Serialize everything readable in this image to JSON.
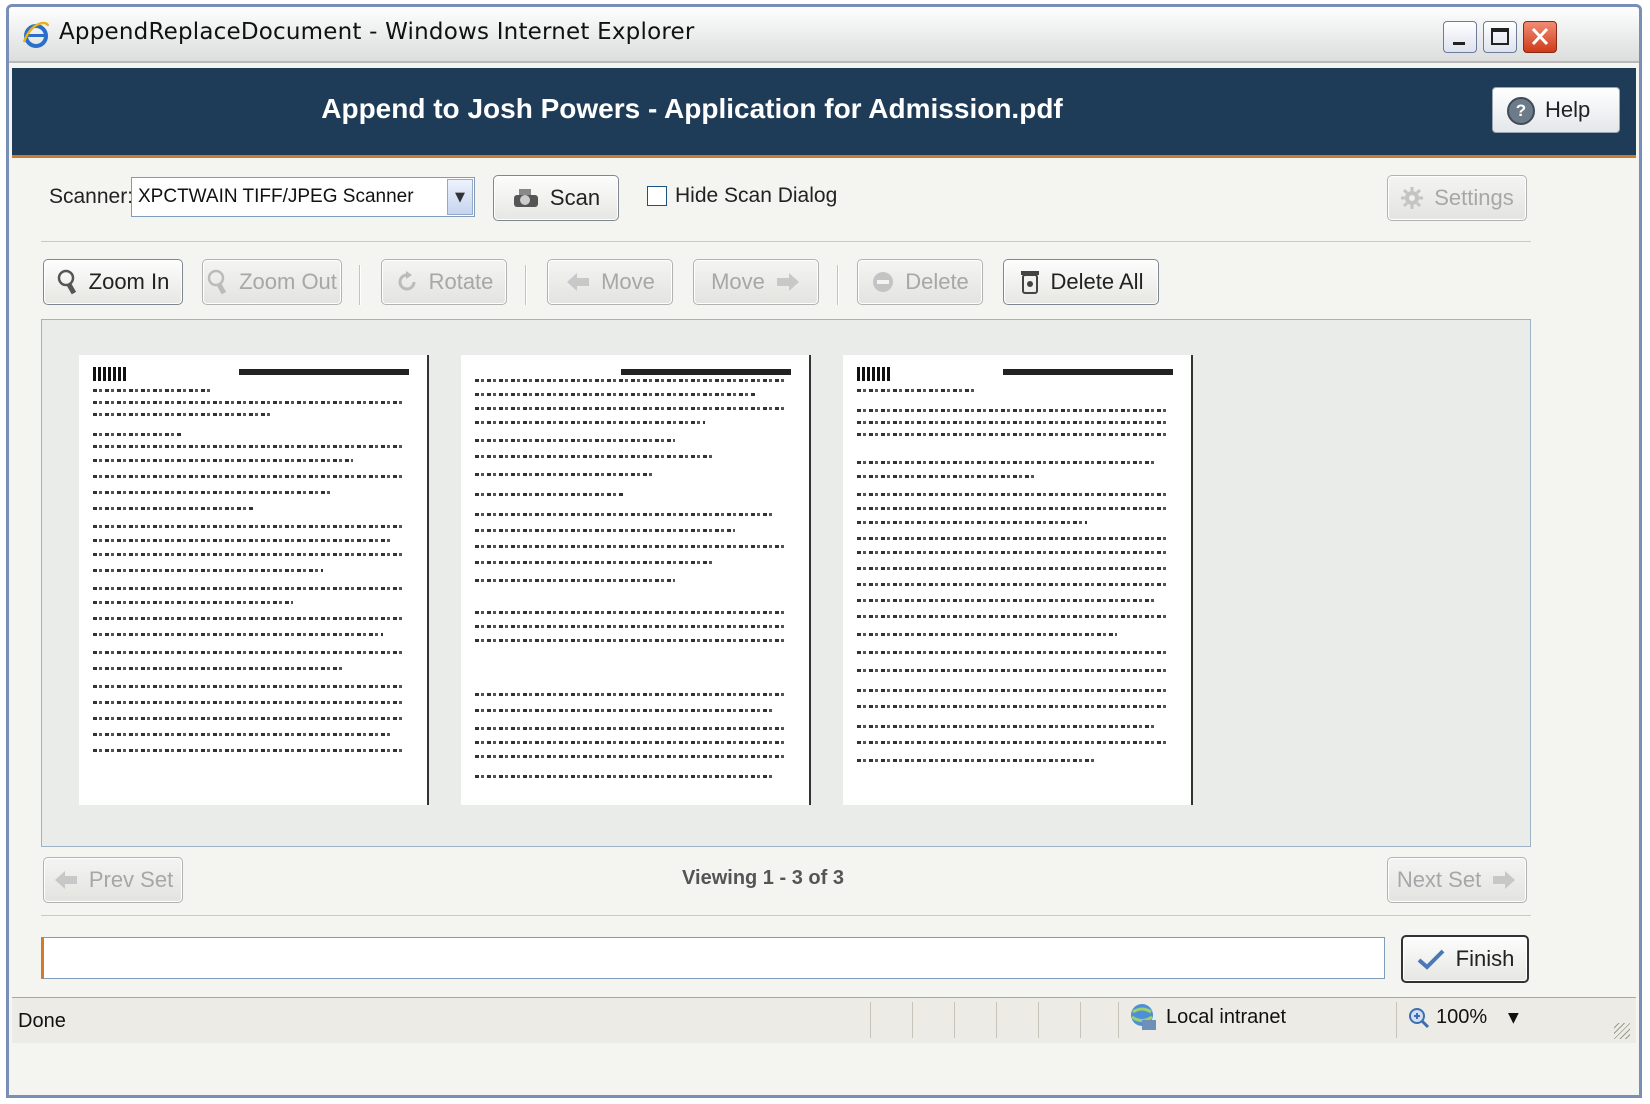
{
  "window": {
    "title": "AppendReplaceDocument - Windows Internet Explorer"
  },
  "header": {
    "title": "Append to Josh Powers - Application for Admission.pdf",
    "help_label": "Help"
  },
  "scan_bar": {
    "scanner_label": "Scanner:",
    "scanner_value": "XPCTWAIN TIFF/JPEG Scanner",
    "scan_label": "Scan",
    "hide_dialog_label": "Hide Scan Dialog",
    "hide_dialog_checked": false,
    "settings_label": "Settings"
  },
  "toolbar": {
    "zoom_in": "Zoom In",
    "zoom_out": "Zoom Out",
    "rotate": "Rotate",
    "move_left": "Move",
    "move_right": "Move",
    "delete": "Delete",
    "delete_all": "Delete All"
  },
  "pager": {
    "prev_label": "Prev Set",
    "next_label": "Next Set",
    "viewing": "Viewing 1 - 3 of 3"
  },
  "footer": {
    "status_value": "",
    "finish_label": "Finish"
  },
  "statusbar": {
    "done": "Done",
    "zone": "Local intranet",
    "zoom": "100%"
  },
  "colors": {
    "header_bg": "#1e3c58",
    "accent": "#d07a2c"
  }
}
